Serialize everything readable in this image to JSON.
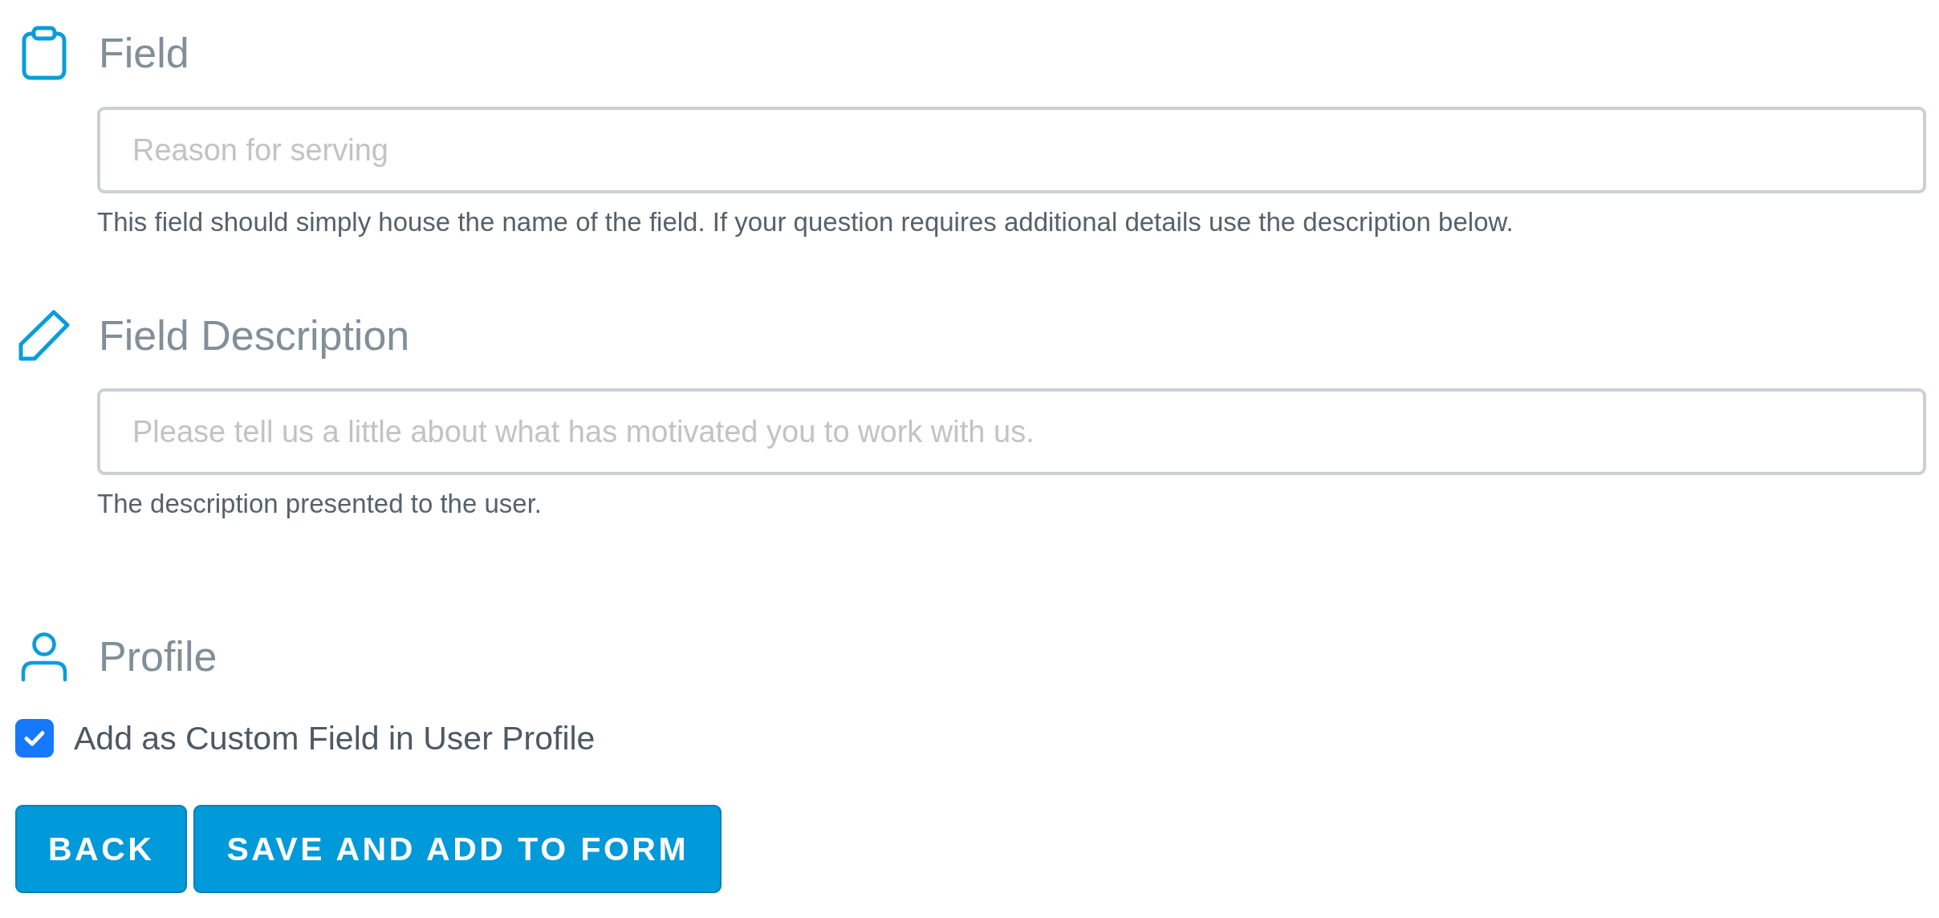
{
  "field": {
    "title": "Field",
    "placeholder": "Reason for serving",
    "help": "This field should simply house the name of the field. If your question requires additional details use the description below."
  },
  "field_description": {
    "title": "Field Description",
    "placeholder": "Please tell us a little about what has motivated you to work with us.",
    "help": "The description presented to the user."
  },
  "profile": {
    "title": "Profile",
    "checkbox": {
      "label": "Add as Custom Field in User Profile",
      "checked": true
    }
  },
  "buttons": [
    {
      "label": "BACK"
    },
    {
      "label": "SAVE AND ADD TO FORM"
    }
  ]
}
